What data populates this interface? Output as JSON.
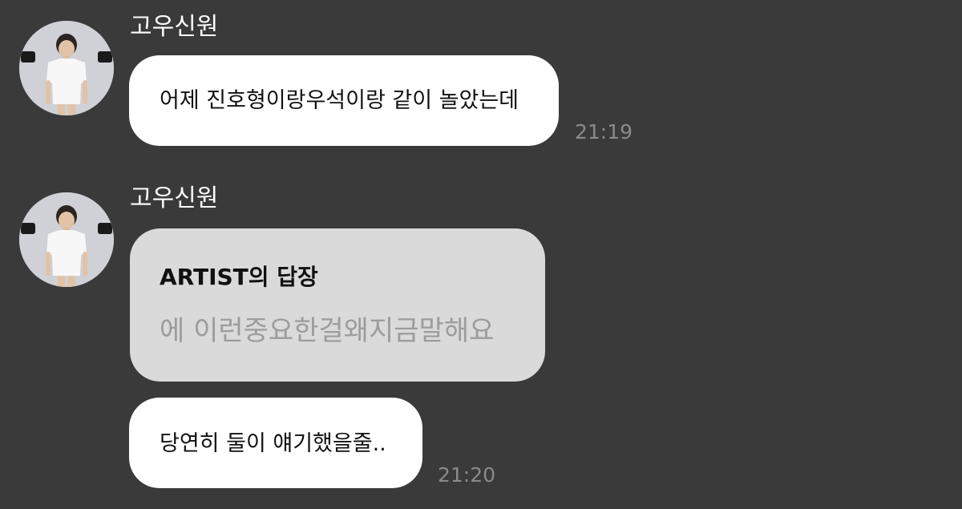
{
  "messages": [
    {
      "sender": "고우신원",
      "avatar_icon": "profile-photo",
      "text": "어제 진호형이랑우석이랑 같이 놀았는데",
      "time": "21:19"
    },
    {
      "sender": "고우신원",
      "avatar_icon": "profile-photo",
      "reply": {
        "title": "ARTIST의 답장",
        "text": "에 이런중요한걸왜지금말해요"
      },
      "text": "당연히 둘이 얘기했을줄..",
      "time": "21:20"
    }
  ],
  "colors": {
    "background": "#3a3a3a",
    "bubble": "#ffffff",
    "reply_bubble": "#dadada",
    "time": "#8a8a8a"
  }
}
